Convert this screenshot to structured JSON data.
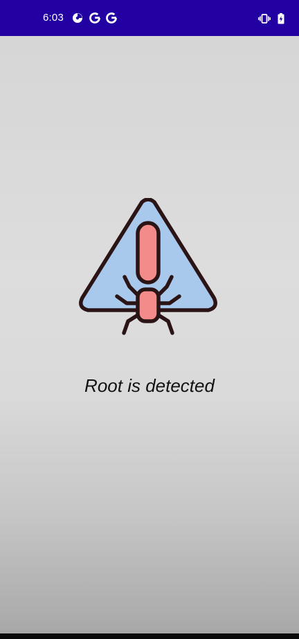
{
  "status_bar": {
    "time": "6:03",
    "notifications": [
      "pie-chart-icon",
      "google-g-icon",
      "google-g-icon"
    ],
    "right_icons": [
      "vibrate-icon",
      "battery-charging-icon"
    ],
    "background_color": "#2200a2"
  },
  "main": {
    "icon": "root-warning-bug-icon",
    "message": "Root is detected"
  }
}
